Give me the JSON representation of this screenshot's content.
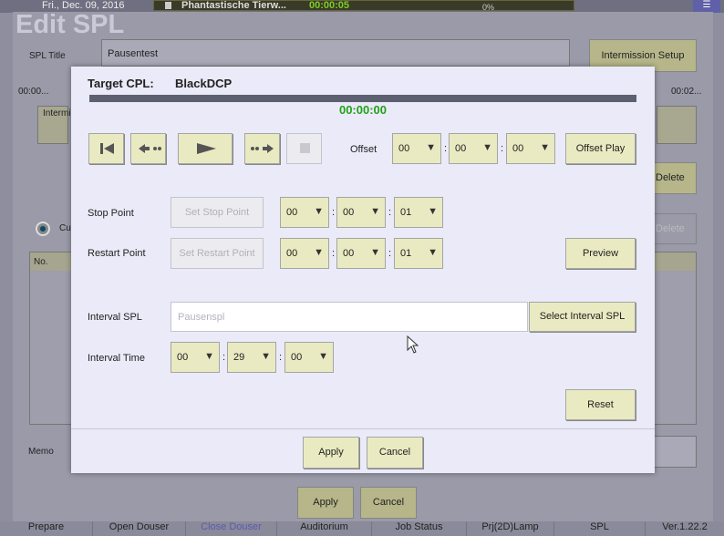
{
  "status_bar": {
    "date": "Fri., Dec. 09, 2016",
    "now_playing_title": "Phantastische Tierw...",
    "now_playing_time": "00:00:05",
    "progress_percent": "0%"
  },
  "background_window": {
    "title": "Edit SPL",
    "spl_title_label": "SPL Title",
    "spl_title_value": "Pausentest",
    "intermission_setup_label": "Intermission Setup",
    "time_left": "00:00...",
    "time_right": "00:02...",
    "intermission_tab": "Intermi",
    "delete_label": "Delete",
    "delete_label_disabled": "Delete",
    "radio_label": "Cu",
    "list_header_no": "No.",
    "memo_label": "Memo",
    "apply_label": "Apply",
    "cancel_label": "Cancel"
  },
  "bottom_tabs": [
    {
      "label": "Prepare"
    },
    {
      "label": "Open Douser"
    },
    {
      "label": "Close Douser"
    },
    {
      "label": "Auditorium"
    },
    {
      "label": "Job Status"
    },
    {
      "label": "Prj(2D)Lamp"
    },
    {
      "label": "SPL"
    },
    {
      "label": "Ver.1.22.2"
    }
  ],
  "dialog": {
    "target_cpl_label": "Target CPL:",
    "target_cpl_value": "BlackDCP",
    "timecode": "00:00:00",
    "playback_progress": 1.0,
    "transport_icons": [
      "skip-to-start-icon",
      "step-back-icon",
      "play-icon",
      "step-forward-icon",
      "stop-icon"
    ],
    "offset": {
      "label": "Offset",
      "hours": "00",
      "minutes": "00",
      "seconds": "00",
      "play_button": "Offset Play"
    },
    "stop_point": {
      "label": "Stop Point",
      "set_button": "Set Stop Point",
      "hours": "00",
      "minutes": "00",
      "seconds": "01"
    },
    "restart_point": {
      "label": "Restart Point",
      "set_button": "Set Restart Point",
      "hours": "00",
      "minutes": "00",
      "seconds": "01",
      "preview_button": "Preview"
    },
    "interval_spl": {
      "label": "Interval SPL",
      "value": "Pausenspl",
      "select_button": "Select Interval SPL"
    },
    "interval_time": {
      "label": "Interval Time",
      "hours": "00",
      "minutes": "29",
      "seconds": "00"
    },
    "reset_button": "Reset",
    "apply_button": "Apply",
    "cancel_button": "Cancel"
  },
  "separator": ":",
  "dropdown_arrow": "▼",
  "colors": {
    "button_face": "#eaeac2",
    "dialog_bg": "#eaeaf8",
    "timecode_green": "#22a018",
    "progress_bar": "#5c6070"
  }
}
